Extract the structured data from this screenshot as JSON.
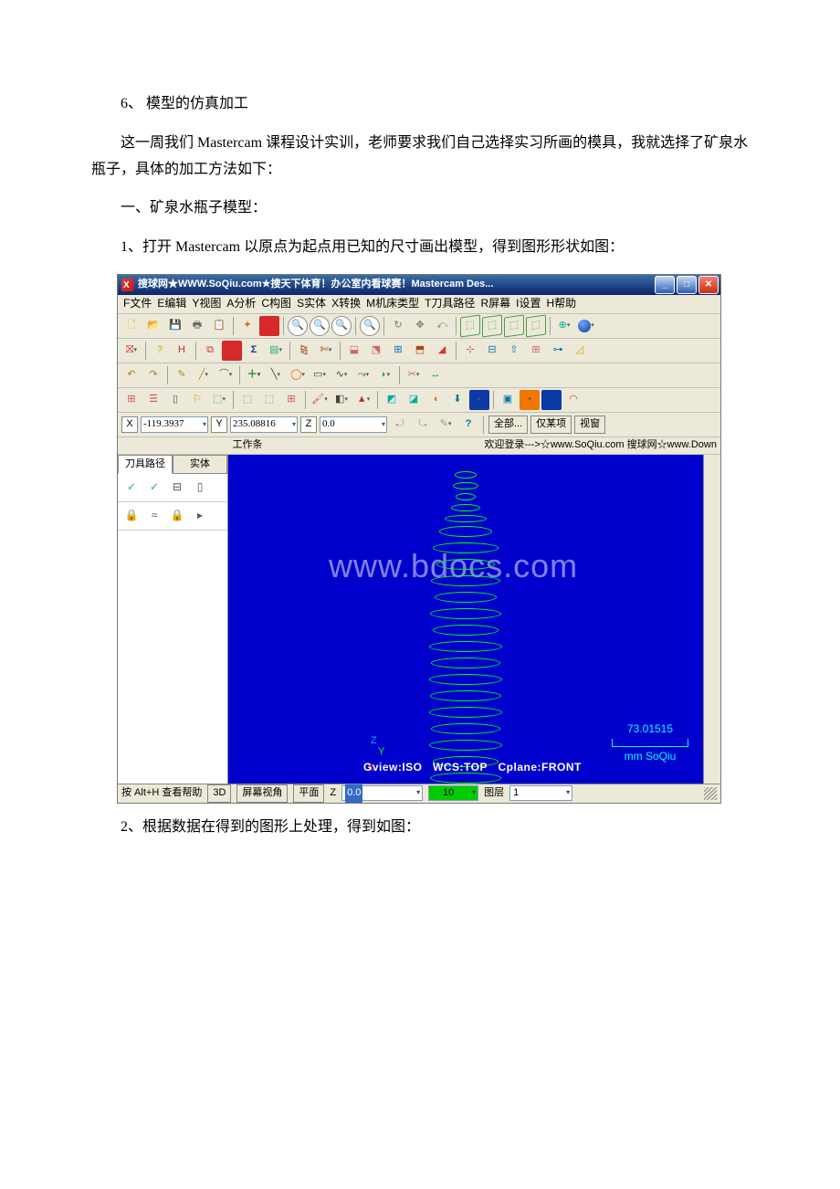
{
  "text": {
    "p1": "6、 模型的仿真加工",
    "p2": "这一周我们 Mastercam 课程设计实训，老师要求我们自己选择实习所画的模具，我就选择了矿泉水瓶子，具体的加工方法如下：",
    "p3": "一、矿泉水瓶子模型：",
    "p4": "1、打开 Mastercam 以原点为起点用已知的尺寸画出模型，得到图形形状如图：",
    "p5": "2、根据数据在得到的图形上处理，得到如图："
  },
  "app": {
    "title": "搜球网★WWW.SoQiu.com★搜天下体育！办公室内看球赛！Mastercam Des...",
    "menu": [
      "F文件",
      "E编辑",
      "Y视图",
      "A分析",
      "C构图",
      "S实体",
      "X转换",
      "M机床类型",
      "T刀具路径",
      "R屏幕",
      "I设置",
      "H帮助"
    ],
    "coord": {
      "x": "-119.3937",
      "y": "235.08816",
      "z": "0.0",
      "all": "全部...",
      "only": "仅某项",
      "view": "视窗"
    },
    "workbar": {
      "label": "工作条",
      "welcome": "欢迎登录--->☆www.SoQiu.com 搜球网☆www.Down"
    },
    "tabs": [
      "刀具路径",
      "实体"
    ],
    "viewport": {
      "gview": "Gview:ISO",
      "wcs": "WCS:TOP",
      "cplane": "Cplane:FRONT",
      "scale": "73.01515",
      "unit": "mm  SoQiu",
      "watermark": "www.bdocs.com"
    },
    "status": {
      "help": "按 Alt+H 查看帮助",
      "mode": "3D",
      "viewangle": "屏幕视角",
      "plane": "平面",
      "zlabel": "Z",
      "z": "0.0",
      "grid": "10",
      "layerlabel": "图层",
      "layer": "1"
    }
  }
}
